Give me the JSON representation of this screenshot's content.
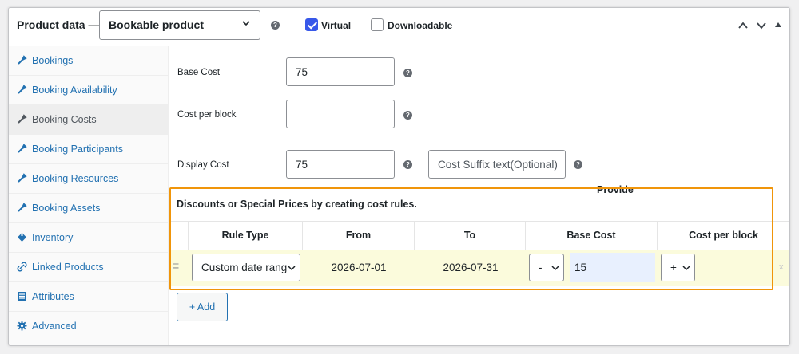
{
  "header": {
    "title": "Product data —",
    "product_type": "Bookable product",
    "virtual_label": "Virtual",
    "virtual_checked": true,
    "downloadable_label": "Downloadable",
    "downloadable_checked": false,
    "help_glyph": "?"
  },
  "sidebar": {
    "items": [
      {
        "label": "Bookings",
        "icon": "wrench-icon"
      },
      {
        "label": "Booking Availability",
        "icon": "wrench-icon"
      },
      {
        "label": "Booking Costs",
        "icon": "wrench-icon",
        "active": true
      },
      {
        "label": "Booking Participants",
        "icon": "wrench-icon"
      },
      {
        "label": "Booking Resources",
        "icon": "wrench-icon"
      },
      {
        "label": "Booking Assets",
        "icon": "wrench-icon"
      },
      {
        "label": "Inventory",
        "icon": "tag-icon"
      },
      {
        "label": "Linked Products",
        "icon": "link-icon"
      },
      {
        "label": "Attributes",
        "icon": "list-icon"
      },
      {
        "label": "Advanced",
        "icon": "gear-icon"
      }
    ]
  },
  "costs": {
    "base_cost_label": "Base Cost",
    "base_cost_value": "75",
    "cost_per_block_label": "Cost per block",
    "cost_per_block_value": "",
    "display_cost_label": "Display Cost",
    "display_cost_value": "75",
    "suffix_placeholder": "Cost Suffix text(Optional)"
  },
  "rules": {
    "title": "Discounts or Special Prices by creating cost rules.",
    "provide_label": "Provide",
    "columns": [
      "Rule Type",
      "From",
      "To",
      "Base Cost",
      "Cost per block"
    ],
    "row": {
      "rule_type": "Custom date range",
      "from": "2026-07-01",
      "to": "2026-07-31",
      "base_modifier": "-",
      "base_cost": "15",
      "block_modifier": "+",
      "block_cost": "",
      "remove_glyph": "x",
      "drag_glyph": "≡"
    },
    "add_button": "+ Add"
  },
  "colors": {
    "accent": "#2271b1",
    "checkbox": "#3858e9",
    "highlight": "#f0950a",
    "row_bg": "#fbfbdc",
    "input_focus": "#e8f0fe"
  }
}
